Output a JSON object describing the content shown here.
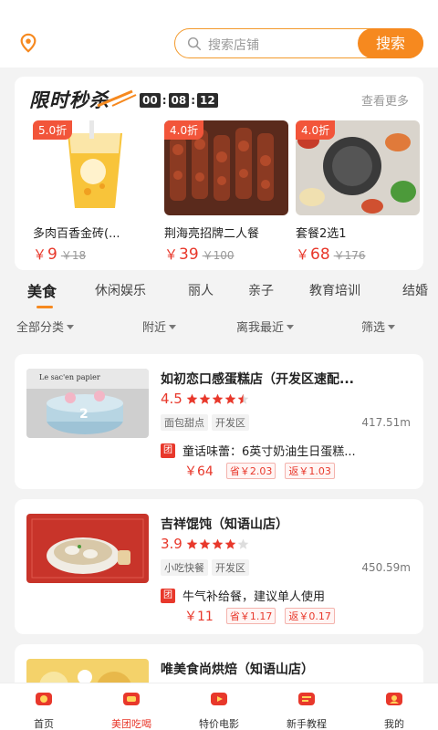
{
  "header": {
    "location_icon": "location-pin-icon",
    "search_placeholder": "搜索店铺",
    "search_button": "搜索"
  },
  "flash_sale": {
    "logo_text": "限时秒杀",
    "timer": [
      "00",
      "08",
      "12"
    ],
    "more": "查看更多",
    "deals": [
      {
        "discount": "5.0折",
        "name": "多肉百香金砖(...",
        "currency": "￥",
        "price": "9",
        "old_price": "￥18"
      },
      {
        "discount": "4.0折",
        "name": "荆海亮招牌二人餐",
        "currency": "￥",
        "price": "39",
        "old_price": "￥100"
      },
      {
        "discount": "4.0折",
        "name": "套餐2选1",
        "currency": "￥",
        "price": "68",
        "old_price": "￥176"
      }
    ]
  },
  "tabs": [
    "美食",
    "休闲娱乐",
    "丽人",
    "亲子",
    "教育培训",
    "结婚"
  ],
  "filters": [
    "全部分类",
    "附近",
    "离我最近",
    "筛选"
  ],
  "stores": [
    {
      "name": "如初恋口感蛋糕店（开发区速配...",
      "score": "4.5",
      "stars": 4.5,
      "tags": [
        "面包甜点",
        "开发区"
      ],
      "distance": "417.51m",
      "group_badge": "团",
      "group_name": "童话味蕾：6英寸奶油生日蛋糕...",
      "group_price": "￥64",
      "save": "省￥2.03",
      "rebate": "返￥1.03"
    },
    {
      "name": "吉祥馄饨（知语山店）",
      "score": "3.9",
      "stars": 4,
      "tags": [
        "小吃快餐",
        "开发区"
      ],
      "distance": "450.59m",
      "group_badge": "团",
      "group_name": "牛气补给餐，建议单人使用",
      "group_price": "￥11",
      "save": "省￥1.17",
      "rebate": "返￥0.17"
    },
    {
      "name": "唯美食尚烘焙（知语山店）"
    }
  ],
  "bottom_nav": [
    {
      "label": "首页",
      "icon": "home-icon"
    },
    {
      "label": "美团吃喝",
      "icon": "food-icon"
    },
    {
      "label": "特价电影",
      "icon": "movie-icon"
    },
    {
      "label": "新手教程",
      "icon": "tutorial-icon"
    },
    {
      "label": "我的",
      "icon": "profile-icon"
    }
  ],
  "colors": {
    "accent": "#f6891f",
    "price": "#e8382b"
  }
}
